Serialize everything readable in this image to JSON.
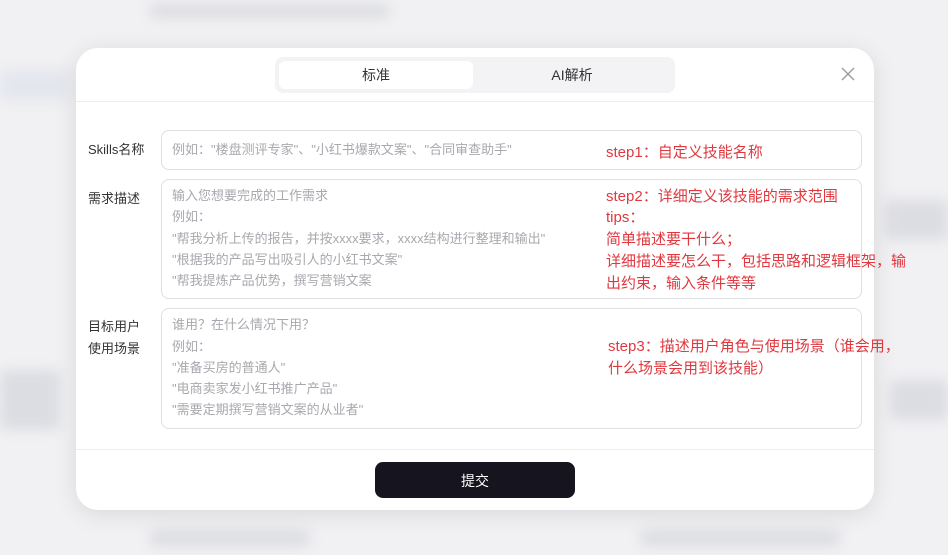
{
  "tabs": [
    {
      "label": "标准"
    },
    {
      "label": "AI解析"
    }
  ],
  "form": {
    "name": {
      "label": "Skills名称",
      "placeholder": "例如：\"楼盘测评专家\"、\"小红书爆款文案\"、\"合同审查助手\""
    },
    "requirement": {
      "label": "需求描述",
      "placeholder_lines": [
        "输入您想要完成的工作需求",
        "例如：",
        "\"帮我分析上传的报告，并按xxxx要求，xxxx结构进行整理和输出\"",
        "\"根据我的产品写出吸引人的小红书文案\"",
        "\"帮我提炼产品优势，撰写营销文案"
      ]
    },
    "target": {
      "label_lines": [
        "目标用户",
        "使用场景"
      ],
      "placeholder_lines": [
        "谁用？在什么情况下用？",
        "例如：",
        "\"准备买房的普通人\"",
        "\"电商卖家发小红书推广产品\"",
        "\"需要定期撰写营销文案的从业者\""
      ]
    }
  },
  "annotations": {
    "step1": "step1：自定义技能名称",
    "step2_lines": [
      "step2：详细定义该技能的需求范围",
      "tips：",
      "简单描述要干什么；",
      "详细描述要怎么干，包括思路和逻辑框架，输",
      "出约束，输入条件等等"
    ],
    "step3_lines": [
      "step3：描述用户角色与使用场景（谁会用，",
      "什么场景会用到该技能）"
    ]
  },
  "submit_label": "提交",
  "colors": {
    "annotation": "#e0383e",
    "submit_bg": "#16151f",
    "placeholder": "#a8a8ae"
  },
  "icons": {
    "close": "close-icon"
  }
}
